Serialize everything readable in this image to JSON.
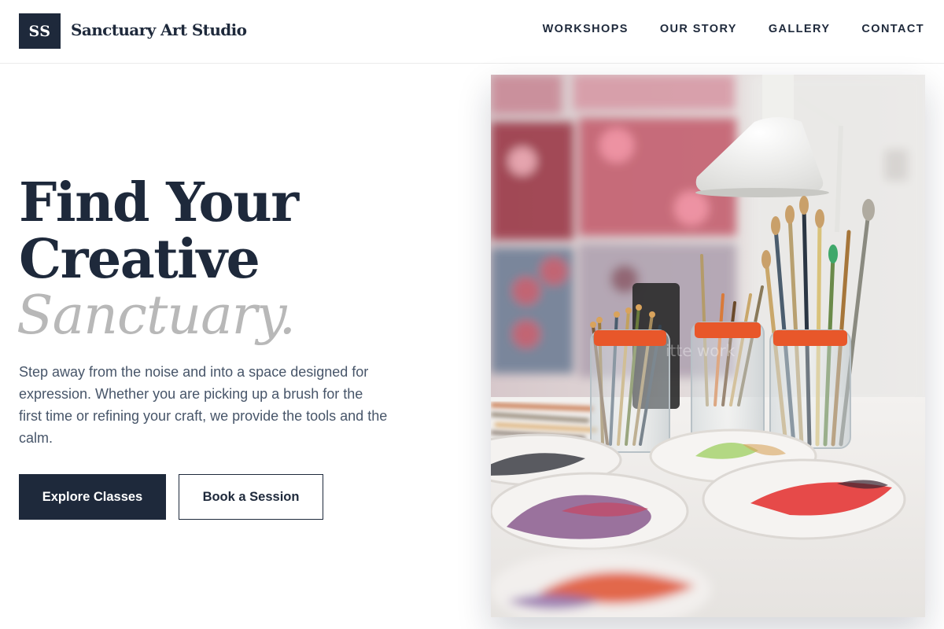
{
  "brand": {
    "mark": "SS",
    "name": "Sanctuary Art Studio"
  },
  "nav": {
    "items": [
      {
        "label": "WORKSHOPS"
      },
      {
        "label": "OUR STORY"
      },
      {
        "label": "GALLERY"
      },
      {
        "label": "CONTACT"
      }
    ]
  },
  "hero": {
    "headline_line1": "Find Your",
    "headline_line2": "Creative",
    "headline_accent": "Sanctuary.",
    "description": "Step away from the noise and into a space designed for expression. Whether you are picking up a brush for the first time or refining your craft, we provide the tools and the calm.",
    "primary_cta": "Explore Classes",
    "secondary_cta": "Book a Session",
    "image_description": "Art studio table with jars of paint brushes and paint-stained palettes",
    "image_watermark": "itte work"
  },
  "colors": {
    "navy": "#1e293b",
    "accent_gray": "#b8b8b8",
    "body_text": "#475569",
    "paint_orange": "#e8572a"
  }
}
